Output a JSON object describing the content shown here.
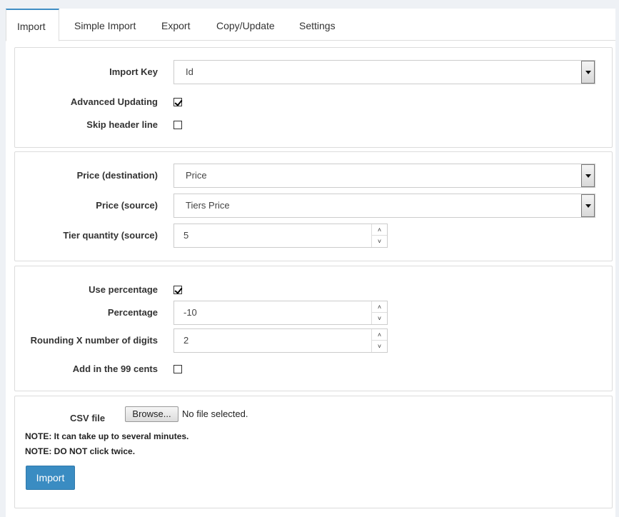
{
  "tabs": [
    "Import",
    "Simple Import",
    "Export",
    "Copy/Update",
    "Settings"
  ],
  "key_panel": {
    "import_key_label": "Import Key",
    "import_key_value": "Id",
    "advanced_updating_label": "Advanced Updating",
    "advanced_updating_checked": true,
    "skip_header_label": "Skip header line",
    "skip_header_checked": false
  },
  "price_panel": {
    "destination_label": "Price (destination)",
    "destination_value": "Price",
    "source_label": "Price (source)",
    "source_value": "Tiers Price",
    "tier_qty_label": "Tier quantity (source)",
    "tier_qty_value": "5"
  },
  "percent_panel": {
    "use_percentage_label": "Use percentage",
    "use_percentage_checked": true,
    "percentage_label": "Percentage",
    "percentage_value": "-10",
    "rounding_label": "Rounding X number of digits",
    "rounding_value": "2",
    "add99_label": "Add in the 99 cents",
    "add99_checked": false
  },
  "file_panel": {
    "csv_label": "CSV file",
    "browse_label": "Browse...",
    "no_file_text": "No file selected.",
    "note1": "NOTE: It can take up to several minutes.",
    "note2": "NOTE: DO NOT click twice.",
    "import_button": "Import"
  },
  "icons": {
    "select_arrow": "triangle-down",
    "spin_up": "chevron-up",
    "spin_down": "chevron-down"
  },
  "colors": {
    "accent": "#3a8cc2",
    "active_tab_border": "#3f8ec4"
  }
}
